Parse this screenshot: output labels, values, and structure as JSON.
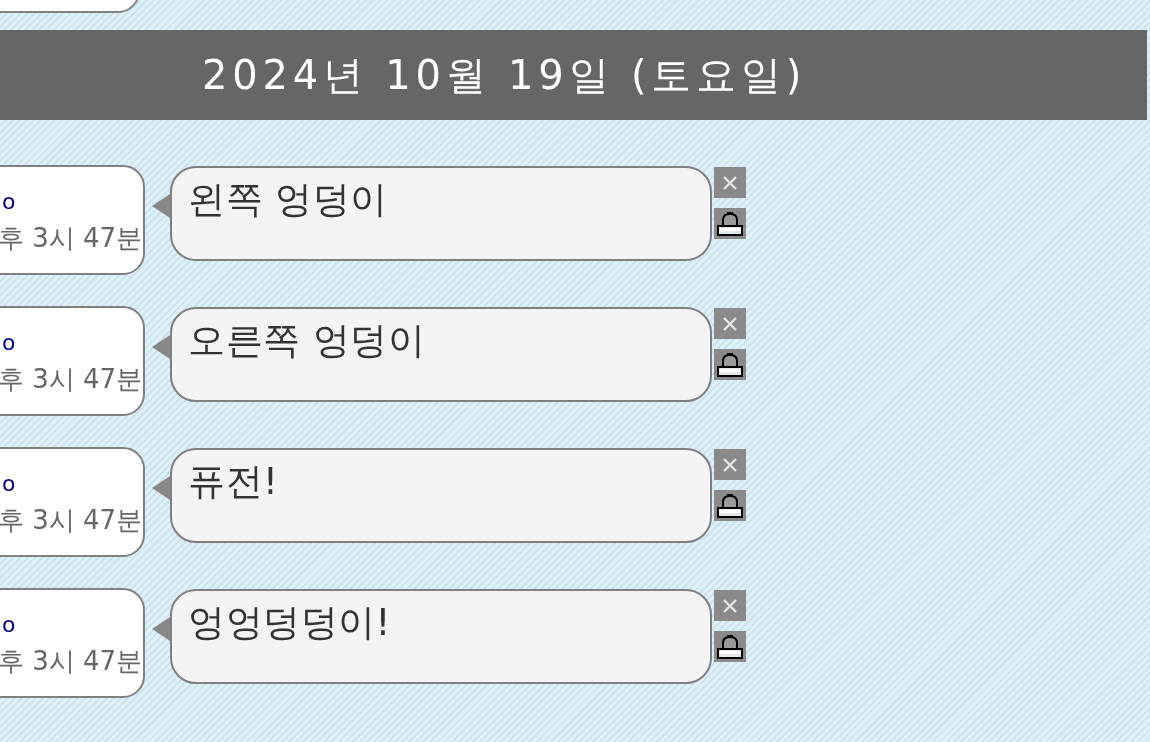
{
  "date_header": "2024년 10월 19일 (토요일)",
  "messages": [
    {
      "label": "o",
      "time": "후 3시 47분",
      "text": "왼쪽 엉덩이"
    },
    {
      "label": "o",
      "time": "후 3시 47분",
      "text": "오른쪽 엉덩이"
    },
    {
      "label": "o",
      "time": "후 3시 47분",
      "text": "퓨전!"
    },
    {
      "label": "o",
      "time": "후 3시 47분",
      "text": "엉엉덩덩이!"
    }
  ]
}
